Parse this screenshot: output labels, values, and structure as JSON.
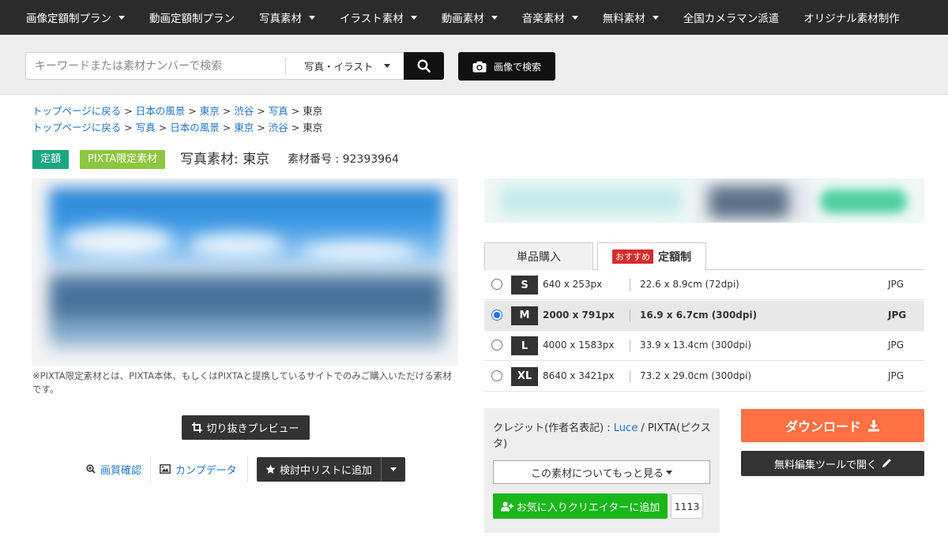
{
  "nav": {
    "items": [
      {
        "label": "画像定額制プラン",
        "dropdown": true
      },
      {
        "label": "動画定額制プラン",
        "dropdown": false
      },
      {
        "label": "写真素材",
        "dropdown": true
      },
      {
        "label": "イラスト素材",
        "dropdown": true
      },
      {
        "label": "動画素材",
        "dropdown": true
      },
      {
        "label": "音楽素材",
        "dropdown": true
      },
      {
        "label": "無料素材",
        "dropdown": true
      },
      {
        "label": "全国カメラマン派遣",
        "dropdown": false
      },
      {
        "label": "オリジナル素材制作",
        "dropdown": false
      }
    ]
  },
  "search": {
    "placeholder": "キーワードまたは素材ナンバーで検索",
    "value": "",
    "category": "写真・イラスト",
    "image_search_label": "画像で検索"
  },
  "breadcrumbs": [
    {
      "links": [
        "トップページに戻る",
        "日本の風景",
        "東京",
        "渋谷",
        "写真"
      ],
      "current": "東京"
    },
    {
      "links": [
        "トップページに戻る",
        "写真",
        "日本の風景",
        "東京",
        "渋谷"
      ],
      "current": "東京"
    }
  ],
  "title_row": {
    "badge_plan": "定額",
    "badge_limited": "PIXTA限定素材",
    "title": "写真素材: 東京",
    "material_number": "素材番号 : 92393964"
  },
  "note": "※PIXTA限定素材とは、PIXTA本体、もしくはPIXTAと提携しているサイトでのみご購入いただける素材です。",
  "tools": {
    "crop_preview": "切り抜きプレビュー",
    "quality_check": "画質確認",
    "comp_data": "カンプデータ",
    "add_wishlist": "検討中リストに追加"
  },
  "tabs": {
    "single": "単品購入",
    "recommended_badge": "おすすめ",
    "plan": "定額制"
  },
  "sizes": [
    {
      "code": "S",
      "px": "640 x 253px",
      "cm": "22.6 x 8.9cm (72dpi)",
      "format": "JPG",
      "selected": false
    },
    {
      "code": "M",
      "px": "2000 x 791px",
      "cm": "16.9 x 6.7cm (300dpi)",
      "format": "JPG",
      "selected": true
    },
    {
      "code": "L",
      "px": "4000 x 1583px",
      "cm": "33.9 x 13.4cm (300dpi)",
      "format": "JPG",
      "selected": false
    },
    {
      "code": "XL",
      "px": "8640 x 3421px",
      "cm": "73.2 x 29.0cm (300dpi)",
      "format": "JPG",
      "selected": false
    }
  ],
  "credit": {
    "prefix": "クレジット(作者名表記) : ",
    "author": "Luce",
    "suffix": " / PIXTA(ピクスタ)",
    "more_label": "この素材についてもっと見る",
    "fav_creator_label": "お気に入りクリエイターに追加",
    "fav_count": "1113"
  },
  "actions": {
    "download_label": "ダウンロード",
    "editor_label": "無料編集ツールで開く"
  },
  "colors": {
    "nav_bg": "#2b2b2b",
    "link": "#1e74c6",
    "badge_plan": "#1aa67e",
    "badge_limited": "#8dc63f",
    "download": "#ff7042",
    "fav_green": "#1ab71a",
    "recommended_red": "#d62d2d"
  }
}
